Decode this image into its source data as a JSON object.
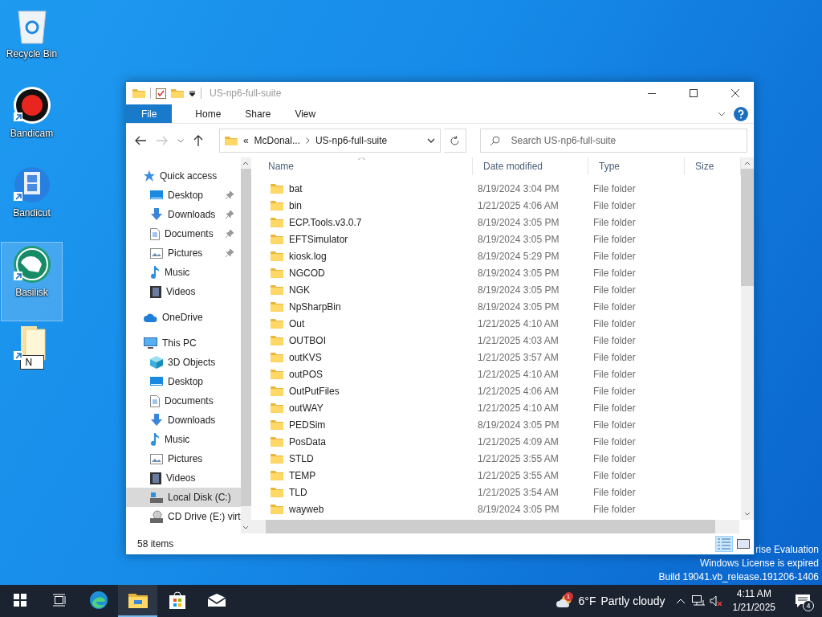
{
  "desktop_icons": [
    {
      "label": "Recycle Bin",
      "kind": "recycle",
      "shortcut": false,
      "selected": false
    },
    {
      "label": "Bandicam",
      "kind": "record",
      "shortcut": true,
      "selected": false
    },
    {
      "label": "Bandicut",
      "kind": "film",
      "shortcut": true,
      "selected": false
    },
    {
      "label": "Basilisk",
      "kind": "bird",
      "shortcut": true,
      "selected": true
    },
    {
      "kind": "folder",
      "shortcut": true,
      "selected": false,
      "rename_value": "N"
    }
  ],
  "window": {
    "title": "US-np6-full-suite",
    "ribbon_tabs": [
      {
        "label": "File",
        "kind": "menu"
      },
      {
        "label": "Home",
        "kind": "tab"
      },
      {
        "label": "Share",
        "kind": "tab"
      },
      {
        "label": "View",
        "kind": "tab"
      }
    ],
    "address": {
      "overflow": "«",
      "segments": [
        "McDonal...",
        "US-np6-full-suite"
      ]
    },
    "search": {
      "placeholder": "Search US-np6-full-suite"
    },
    "nav": [
      {
        "label": "Quick access",
        "kind": "star",
        "selected": false,
        "children": [
          {
            "label": "Desktop",
            "kind": "desktop",
            "pinned": true,
            "selected": false
          },
          {
            "label": "Downloads",
            "kind": "downloads",
            "pinned": true,
            "selected": false
          },
          {
            "label": "Documents",
            "kind": "documents",
            "pinned": true,
            "selected": false
          },
          {
            "label": "Pictures",
            "kind": "pictures",
            "pinned": true,
            "selected": false
          },
          {
            "label": "Music",
            "kind": "music",
            "pinned": false,
            "selected": false
          },
          {
            "label": "Videos",
            "kind": "videos",
            "pinned": false,
            "selected": false
          }
        ]
      },
      {
        "label": "OneDrive",
        "kind": "cloud",
        "selected": false
      },
      {
        "label": "This PC",
        "kind": "pc",
        "selected": false,
        "children": [
          {
            "label": "3D Objects",
            "kind": "cube",
            "pinned": false,
            "selected": false
          },
          {
            "label": "Desktop",
            "kind": "desktop",
            "pinned": false,
            "selected": false
          },
          {
            "label": "Documents",
            "kind": "documents",
            "pinned": false,
            "selected": false
          },
          {
            "label": "Downloads",
            "kind": "downloads",
            "pinned": false,
            "selected": false
          },
          {
            "label": "Music",
            "kind": "music",
            "pinned": false,
            "selected": false
          },
          {
            "label": "Pictures",
            "kind": "pictures",
            "pinned": false,
            "selected": false
          },
          {
            "label": "Videos",
            "kind": "videos",
            "pinned": false,
            "selected": false
          },
          {
            "label": "Local Disk (C:)",
            "kind": "drive",
            "pinned": false,
            "selected": true
          },
          {
            "label": "CD Drive (E:) virt",
            "kind": "cd",
            "pinned": false,
            "selected": false
          }
        ]
      }
    ],
    "columns": [
      "Name",
      "Date modified",
      "Type",
      "Size"
    ],
    "rows": [
      {
        "name": "bat",
        "date": "8/19/2024 3:04 PM",
        "type": "File folder"
      },
      {
        "name": "bin",
        "date": "1/21/2025 4:06 AM",
        "type": "File folder"
      },
      {
        "name": "ECP.Tools.v3.0.7",
        "date": "8/19/2024 3:05 PM",
        "type": "File folder"
      },
      {
        "name": "EFTSimulator",
        "date": "8/19/2024 3:05 PM",
        "type": "File folder"
      },
      {
        "name": "kiosk.log",
        "date": "8/19/2024 5:29 PM",
        "type": "File folder"
      },
      {
        "name": "NGCOD",
        "date": "8/19/2024 3:05 PM",
        "type": "File folder"
      },
      {
        "name": "NGK",
        "date": "8/19/2024 3:05 PM",
        "type": "File folder"
      },
      {
        "name": "NpSharpBin",
        "date": "8/19/2024 3:05 PM",
        "type": "File folder"
      },
      {
        "name": "Out",
        "date": "1/21/2025 4:10 AM",
        "type": "File folder"
      },
      {
        "name": "OUTBOI",
        "date": "1/21/2025 4:03 AM",
        "type": "File folder"
      },
      {
        "name": "outKVS",
        "date": "1/21/2025 3:57 AM",
        "type": "File folder"
      },
      {
        "name": "outPOS",
        "date": "1/21/2025 4:10 AM",
        "type": "File folder"
      },
      {
        "name": "OutPutFiles",
        "date": "1/21/2025 4:06 AM",
        "type": "File folder"
      },
      {
        "name": "outWAY",
        "date": "1/21/2025 4:10 AM",
        "type": "File folder"
      },
      {
        "name": "PEDSim",
        "date": "8/19/2024 3:05 PM",
        "type": "File folder"
      },
      {
        "name": "PosData",
        "date": "1/21/2025 4:09 AM",
        "type": "File folder"
      },
      {
        "name": "STLD",
        "date": "1/21/2025 3:55 AM",
        "type": "File folder"
      },
      {
        "name": "TEMP",
        "date": "1/21/2025 3:55 AM",
        "type": "File folder"
      },
      {
        "name": "TLD",
        "date": "1/21/2025 3:54 AM",
        "type": "File folder"
      },
      {
        "name": "wayweb",
        "date": "8/19/2024 3:05 PM",
        "type": "File folder"
      }
    ],
    "status": "58 items"
  },
  "watermark_lines": [
    "rise Evaluation",
    "Windows License is expired",
    "Build 19041.vb_release.191206-1406"
  ],
  "taskbar": {
    "weather": {
      "badge": "1",
      "temperature": "6°F",
      "condition": "Partly cloudy"
    },
    "time": "4:11 AM",
    "date": "1/21/2025",
    "notification_count": "4"
  }
}
